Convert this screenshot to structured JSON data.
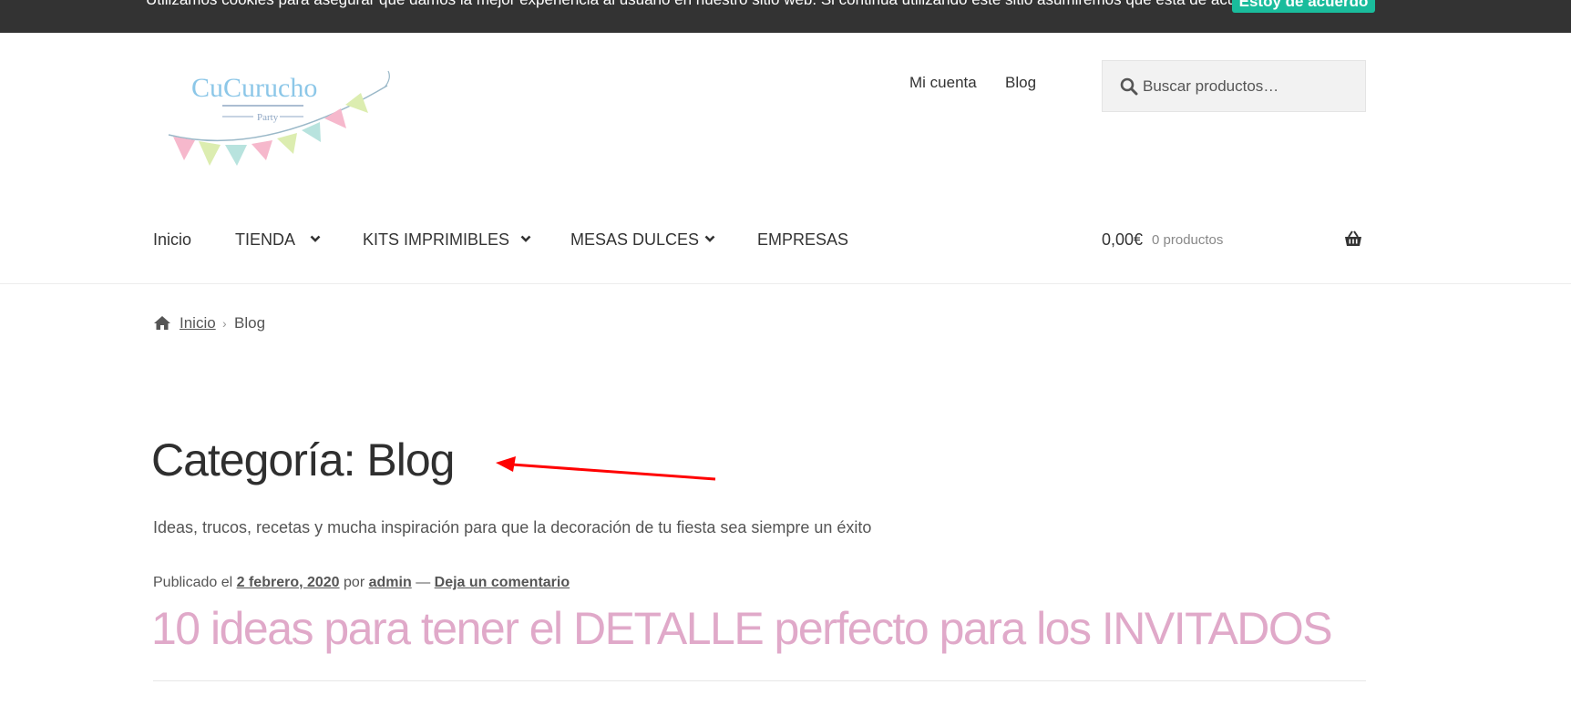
{
  "cookie_bar": {
    "text": "Utilizamos cookies para asegurar que damos la mejor experiencia al usuario en nuestro sitio web. Si continúa utilizando este sitio asumiremos que está de acuerdo.",
    "accept_label": "Estoy de acuerdo",
    "accept_color": "#1abc9c"
  },
  "logo": {
    "text": "CuCurucho",
    "subtext": "Party"
  },
  "top_nav": {
    "items": [
      "Mi cuenta",
      "Blog"
    ]
  },
  "search": {
    "placeholder": "Buscar productos…",
    "icon": "search-icon"
  },
  "main_nav": {
    "items": [
      {
        "label": "Inicio",
        "has_dropdown": false
      },
      {
        "label": "TIENDA",
        "has_dropdown": true
      },
      {
        "label": "KITS IMPRIMIBLES",
        "has_dropdown": true
      },
      {
        "label": "MESAS DULCES",
        "has_dropdown": true
      },
      {
        "label": "EMPRESAS",
        "has_dropdown": false
      }
    ]
  },
  "cart": {
    "amount": "0,00€",
    "count": "0 productos",
    "icon": "basket-icon"
  },
  "breadcrumb": {
    "home": "Inicio",
    "current": "Blog",
    "icon": "home-icon"
  },
  "page": {
    "title": "Categoría: Blog",
    "description": "Ideas, trucos, recetas y mucha inspiración para que la decoración de tu fiesta sea siempre un éxito"
  },
  "post": {
    "meta_prefix": "Publicado el",
    "date": "2 febrero, 2020",
    "by": "por",
    "author": "admin",
    "dash": "—",
    "comment_link": "Deja un comentario",
    "title": "10 ideas para tener el DETALLE perfecto para los INVITADOS",
    "title_color": "#e0a9c9"
  },
  "annotation": {
    "arrow_color": "#ff0000"
  }
}
